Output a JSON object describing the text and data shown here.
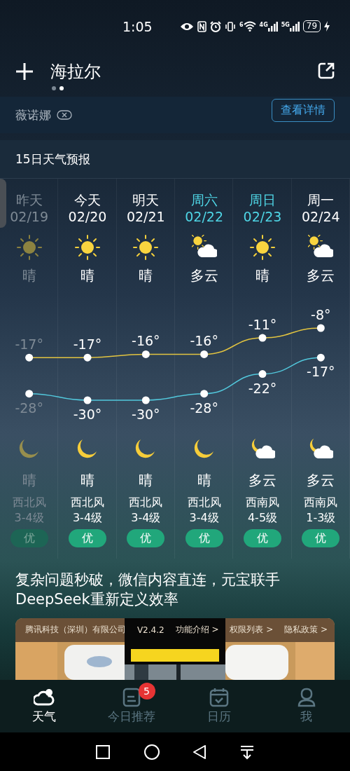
{
  "status_bar": {
    "time": "1:05",
    "wifi_badge": "6",
    "networks": [
      "4G",
      "5G"
    ],
    "battery": "79"
  },
  "header": {
    "city": "海拉尔",
    "pages": [
      {
        "selected": false
      },
      {
        "selected": true
      }
    ]
  },
  "alert": {
    "label": "薇诺娜",
    "button": "查看详情"
  },
  "forecast": {
    "title": "15日天气预报",
    "days": [
      {
        "day": "昨天",
        "date": "02/19",
        "past": true,
        "weekend": false,
        "daytime": {
          "kind": "sun",
          "condition": "晴"
        },
        "night": {
          "kind": "moon",
          "condition": "晴"
        },
        "wind": "西北风",
        "wind_level": "3-4级",
        "aqi": "优"
      },
      {
        "day": "今天",
        "date": "02/20",
        "past": false,
        "weekend": false,
        "daytime": {
          "kind": "sun",
          "condition": "晴"
        },
        "night": {
          "kind": "moon",
          "condition": "晴"
        },
        "wind": "西北风",
        "wind_level": "3-4级",
        "aqi": "优"
      },
      {
        "day": "明天",
        "date": "02/21",
        "past": false,
        "weekend": false,
        "daytime": {
          "kind": "sun",
          "condition": "晴"
        },
        "night": {
          "kind": "moon",
          "condition": "晴"
        },
        "wind": "西北风",
        "wind_level": "3-4级",
        "aqi": "优"
      },
      {
        "day": "周六",
        "date": "02/22",
        "past": false,
        "weekend": true,
        "daytime": {
          "kind": "partly-cloudy",
          "condition": "多云"
        },
        "night": {
          "kind": "moon",
          "condition": "晴"
        },
        "wind": "西北风",
        "wind_level": "3-4级",
        "aqi": "优"
      },
      {
        "day": "周日",
        "date": "02/23",
        "past": false,
        "weekend": true,
        "daytime": {
          "kind": "sun",
          "condition": "晴"
        },
        "night": {
          "kind": "moon-cloud",
          "condition": "多云"
        },
        "wind": "西南风",
        "wind_level": "4-5级",
        "aqi": "优"
      },
      {
        "day": "周一",
        "date": "02/24",
        "past": false,
        "weekend": false,
        "daytime": {
          "kind": "partly-cloudy",
          "condition": "多云"
        },
        "night": {
          "kind": "moon-cloud",
          "condition": "多云"
        },
        "wind": "西南风",
        "wind_level": "1-3级",
        "aqi": "优"
      }
    ],
    "chart_data": {
      "type": "line",
      "series": [
        {
          "color": "#e2c440",
          "marker": "circle",
          "values": [
            -17,
            -17,
            -16,
            -16,
            -11,
            -8
          ],
          "value_labels": [
            "-17°",
            "-17°",
            "-16°",
            "-16°",
            "-11°",
            "-8°"
          ]
        },
        {
          "color": "#52c8dc",
          "marker": "circle",
          "values": [
            -28,
            -30,
            -30,
            -28,
            -22,
            -17
          ],
          "value_labels": [
            "-28°",
            "-30°",
            "-30°",
            "-28°",
            "-22°",
            "-17°"
          ]
        }
      ]
    }
  },
  "ad": {
    "headline": "复杂问题秒破，微信内容直连，元宝联手DeepSeek重新定义效率",
    "publisher": "腾讯科技（深圳）有限公司",
    "version": "V2.4.2",
    "links": [
      "功能介绍 >",
      "权限列表 >",
      "隐私政策 >"
    ]
  },
  "nav": [
    {
      "label": "天气",
      "selected": true
    },
    {
      "label": "今日推荐",
      "selected": false,
      "badge": "5"
    },
    {
      "label": "日历",
      "selected": false
    },
    {
      "label": "我",
      "selected": false
    }
  ]
}
